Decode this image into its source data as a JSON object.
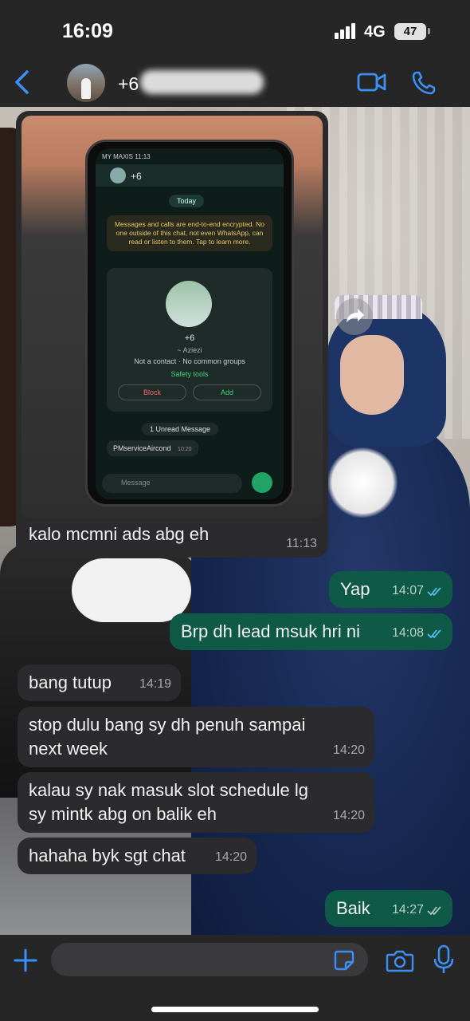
{
  "status_bar": {
    "time": "16:09",
    "network": "4G",
    "battery": "47"
  },
  "header": {
    "contact_name": "+6",
    "icons": [
      "back-icon",
      "video-call-icon",
      "voice-call-icon"
    ]
  },
  "image_message": {
    "caption": "kalo mcmni ads abg eh",
    "time": "11:13",
    "screen": {
      "carrier": "MY MAXIS 11:13",
      "number": "+6",
      "today": "Today",
      "encryption": "Messages and calls are end-to-end encrypted. No one outside of this chat, not even WhatsApp, can read or listen to them. Tap to learn more.",
      "contact_alias": "~ Aziezi",
      "contact_note": "Not a contact · No common groups",
      "safety": "Safety tools",
      "block": "Block",
      "add": "Add",
      "unread": "1 Unread Message",
      "message": "PMserviceAircond",
      "message_time": "10:20",
      "input_placeholder": "Message"
    }
  },
  "messages": [
    {
      "id": "m1",
      "direction": "out",
      "text": "Yap",
      "time": "14:07",
      "status": "read"
    },
    {
      "id": "m2",
      "direction": "out",
      "text": "Brp dh lead msuk hri ni",
      "time": "14:08",
      "status": "read"
    },
    {
      "id": "m3",
      "direction": "in",
      "text": "bang tutup",
      "time": "14:19"
    },
    {
      "id": "m4",
      "direction": "in",
      "text": "stop dulu bang sy dh penuh sampai next week",
      "time": "14:20"
    },
    {
      "id": "m5",
      "direction": "in",
      "text": "kalau sy nak masuk slot schedule lg sy mintk abg on balik eh",
      "time": "14:20"
    },
    {
      "id": "m6",
      "direction": "in",
      "text": "hahaha byk sgt chat",
      "time": "14:20"
    },
    {
      "id": "m7",
      "direction": "out",
      "text": "Baik",
      "time": "14:27",
      "status": "delivered"
    }
  ],
  "composer": {
    "placeholder": "",
    "icons": [
      "plus-icon",
      "sticker-icon",
      "camera-icon",
      "mic-icon"
    ]
  },
  "colors": {
    "outgoing": "#0f5a46",
    "incoming": "#2b2b2d",
    "accent": "#3c8ff5",
    "read_ticks": "#53bdeb"
  }
}
